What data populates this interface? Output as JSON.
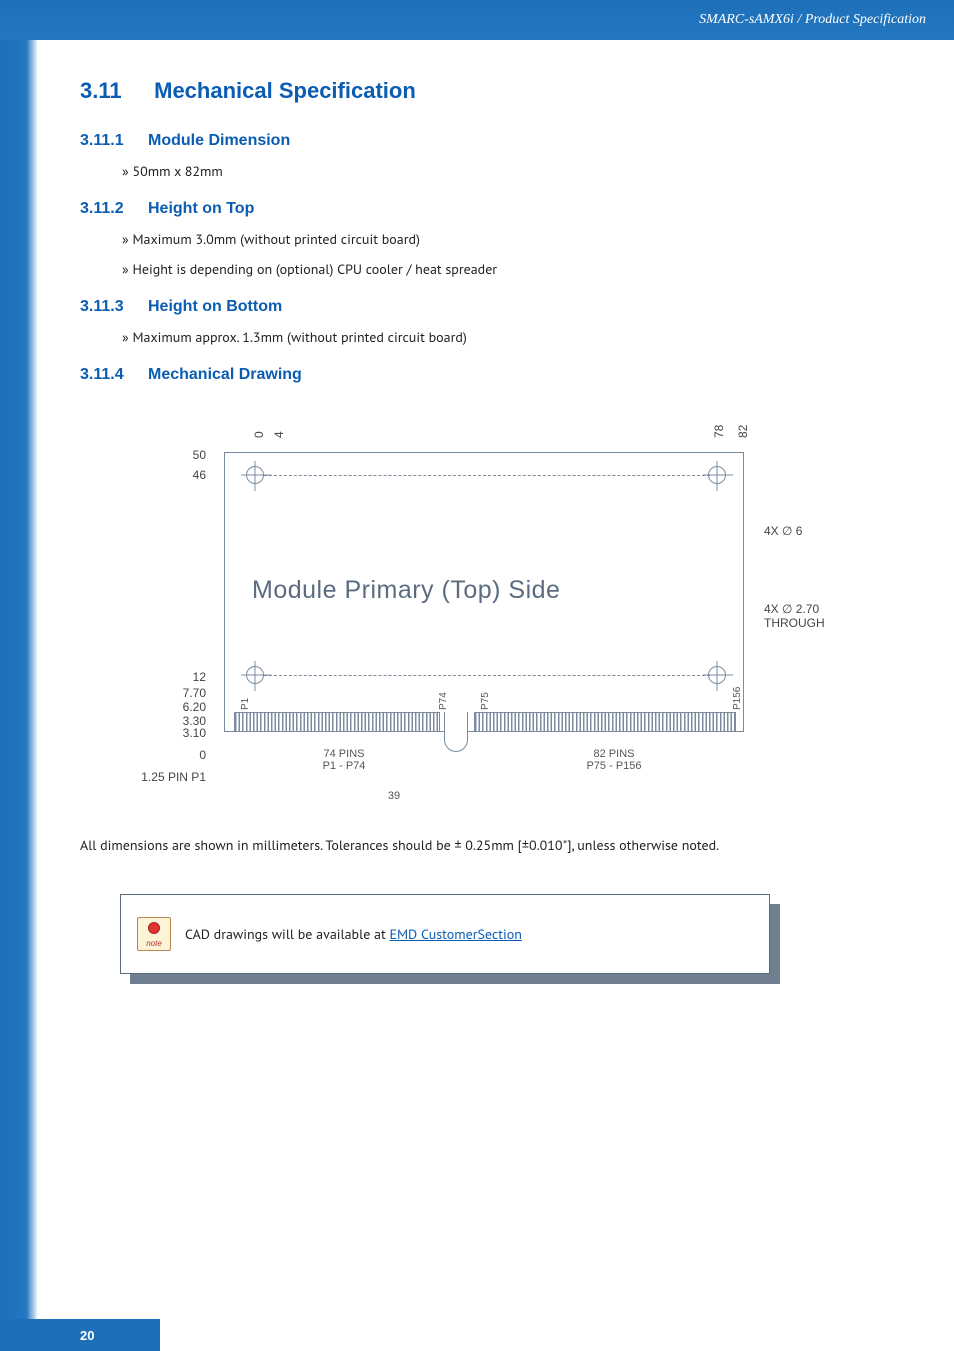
{
  "header": {
    "breadcrumb": "SMARC-sAMX6i / Product Specification"
  },
  "section": {
    "number": "3.11",
    "title": "Mechanical Specification"
  },
  "subs": [
    {
      "number": "3.11.1",
      "title": "Module Dimension",
      "bullets": [
        "50mm x 82mm"
      ]
    },
    {
      "number": "3.11.2",
      "title": "Height on Top",
      "bullets": [
        "Maximum 3.0mm (without printed circuit board)",
        "Height is depending on (optional) CPU cooler / heat spreader"
      ]
    },
    {
      "number": "3.11.3",
      "title": "Height on Bottom",
      "bullets": [
        "Maximum approx. 1.3mm (without printed circuit board)"
      ]
    },
    {
      "number": "3.11.4",
      "title": "Mechanical Drawing",
      "bullets": []
    }
  ],
  "drawing": {
    "title": "Module Primary (Top) Side",
    "left_dims": [
      "50",
      "46",
      "12",
      "7.70",
      "6.20",
      "3.30",
      "3.10",
      "0",
      "1.25 PIN P1"
    ],
    "top_dims": [
      "0",
      "4",
      "78",
      "82"
    ],
    "right_labels": [
      "4X ∅ 6",
      "4X ∅ 2.70\nTHROUGH"
    ],
    "pins": {
      "p1": "P1",
      "p74": "P74",
      "p75": "P75",
      "p156": "P156"
    },
    "under": {
      "left": "74 PINS\nP1 - P74",
      "right": "82 PINS\nP75 - P156",
      "len": "39"
    }
  },
  "tolerance_note": "All dimensions are shown in millimeters. Tolerances should be ± 0.25mm [±0.010\"], unless otherwise noted.",
  "callout": {
    "icon_text": "note",
    "text_prefix": "CAD drawings will be available at ",
    "link_text": "EMD CustomerSection"
  },
  "page_number": "20"
}
